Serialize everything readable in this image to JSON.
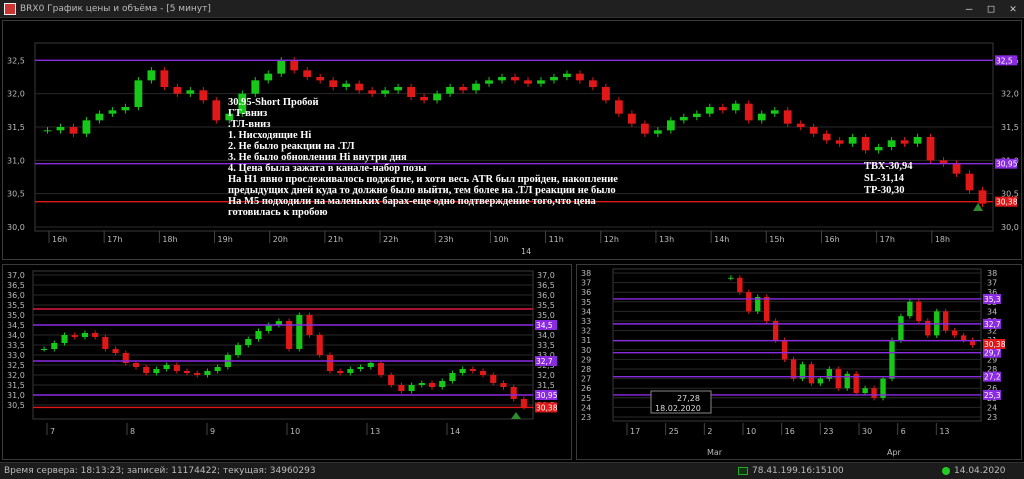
{
  "window": {
    "title": "BRX0 График цены и объёма - [5 минут]",
    "min_glyph": "–",
    "max_glyph": "□",
    "close_glyph": "✕"
  },
  "colors": {
    "bull": "#18c818",
    "bear": "#e01818",
    "level": "#8a2be2",
    "resist": "#e01840",
    "grid": "#2a2a2a",
    "axis": "#bbbbbb"
  },
  "main_chart": {
    "chart_data": {
      "type": "candlestick",
      "ylim": [
        30.0,
        32.7
      ],
      "yticks": [
        "32,5",
        "32,0",
        "31,5",
        "31,0",
        "30,5",
        "30,0"
      ],
      "ytick_values": [
        32.5,
        32.0,
        31.5,
        31.0,
        30.5,
        30.0
      ],
      "xticks": [
        "16h",
        "17h",
        "18h",
        "19h",
        "20h",
        "21h",
        "22h",
        "23h",
        "10h",
        "11h",
        "12h",
        "13h",
        "14h",
        "15h",
        "16h",
        "17h",
        "18h"
      ],
      "date_label": "14",
      "levels": [
        {
          "value": 32.5,
          "label": "32,5",
          "color": "#8a2be2"
        },
        {
          "value": 30.95,
          "label": "30,95",
          "color": "#8a2be2"
        },
        {
          "value": 30.38,
          "label": "30,38",
          "color": "#e01818"
        }
      ],
      "closes": [
        31.45,
        31.5,
        31.4,
        31.6,
        31.7,
        31.75,
        31.8,
        32.2,
        32.35,
        32.1,
        32.0,
        32.05,
        31.9,
        31.6,
        31.7,
        32.0,
        32.2,
        32.3,
        32.5,
        32.35,
        32.25,
        32.2,
        32.1,
        32.15,
        32.05,
        32.0,
        32.05,
        32.1,
        31.95,
        31.9,
        32.0,
        32.1,
        32.05,
        32.15,
        32.2,
        32.25,
        32.2,
        32.15,
        32.2,
        32.25,
        32.3,
        32.2,
        32.1,
        31.9,
        31.7,
        31.55,
        31.4,
        31.45,
        31.6,
        31.65,
        31.7,
        31.8,
        31.75,
        31.85,
        31.6,
        31.7,
        31.75,
        31.55,
        31.5,
        31.4,
        31.3,
        31.25,
        31.35,
        31.15,
        31.2,
        31.3,
        31.25,
        31.35,
        31.0,
        30.95,
        30.8,
        30.55,
        30.35
      ],
      "tick_count": 17
    },
    "annotation_lines": [
      "30.95-Short Пробой",
      "ГТ-вниз",
      ".ТЛ-вниз",
      "1. Нисходящие Hi",
      "2. Не было реакции на .ТЛ",
      "3. Не было обновления Hi внутри дня",
      "4. Цена была зажата в канале-набор позы",
      "На H1 явно прослеживалось поджатие, и хотя весь ATR был пройден, накопление",
      "предыдущих дней куда то должно было выйти, тем более на .ТЛ реакции не было",
      "На М5 подходили на маленьких барах-еще одно подтверждение того,что цена",
      "готовилась к пробою"
    ],
    "trade": {
      "entry": "ТВХ-30,94",
      "stop": "SL-31,14",
      "target": "TP-30,30"
    }
  },
  "lower_left_chart": {
    "chart_data": {
      "type": "candlestick",
      "ylim": [
        30.0,
        37.0
      ],
      "yticks": [
        "37,0",
        "36,5",
        "36,0",
        "35,5",
        "35,0",
        "34,5",
        "34,0",
        "33,5",
        "33,0",
        "32,5",
        "32,0",
        "31,5",
        "31,0",
        "30,5"
      ],
      "xticks": [
        "7",
        "8",
        "9",
        "10",
        "13",
        "14"
      ],
      "levels": [
        {
          "value": 35.3,
          "label": "",
          "color": "#e01840"
        },
        {
          "value": 34.5,
          "label": "34,5",
          "color": "#8a2be2"
        },
        {
          "value": 32.7,
          "label": "32,7",
          "color": "#8a2be2"
        },
        {
          "value": 31.0,
          "label": "30,95",
          "color": "#8a2be2"
        },
        {
          "value": 30.38,
          "label": "30,38",
          "color": "#e01818"
        }
      ],
      "closes": [
        33.3,
        33.6,
        34.0,
        33.9,
        34.1,
        33.9,
        33.3,
        33.1,
        32.6,
        32.4,
        32.1,
        32.3,
        32.5,
        32.2,
        32.1,
        32.0,
        32.2,
        32.4,
        33.0,
        33.5,
        33.8,
        34.2,
        34.5,
        34.7,
        33.3,
        35.0,
        34.0,
        33.0,
        32.2,
        32.1,
        32.3,
        32.4,
        32.6,
        32.0,
        31.5,
        31.2,
        31.5,
        31.6,
        31.4,
        31.7,
        32.1,
        32.3,
        32.2,
        32.0,
        31.6,
        31.4,
        30.8,
        30.4
      ]
    }
  },
  "lower_right_chart": {
    "chart_data": {
      "type": "candlestick",
      "ylim": [
        23,
        38
      ],
      "yticks": [
        "38",
        "37",
        "36",
        "35",
        "34",
        "33",
        "32",
        "31",
        "30",
        "29",
        "28",
        "27",
        "26",
        "25",
        "24",
        "23"
      ],
      "xticks": [
        "17",
        "25",
        "2",
        "10",
        "16",
        "23",
        "30",
        "6",
        "13"
      ],
      "month_labels": [
        "Mar",
        "Apr"
      ],
      "levels": [
        {
          "value": 35.3,
          "label": "35,3",
          "color": "#8a2be2"
        },
        {
          "value": 32.7,
          "label": "32,7",
          "color": "#8a2be2"
        },
        {
          "value": 30.95,
          "label": "",
          "color": "#8a2be2"
        },
        {
          "value": 29.7,
          "label": "29,7",
          "color": "#8a2be2"
        },
        {
          "value": 27.2,
          "label": "27,2",
          "color": "#8a2be2"
        },
        {
          "value": 25.3,
          "label": "25,3",
          "color": "#8a2be2"
        }
      ],
      "cursor_value": "27,28",
      "cursor_date": "18.02.2020",
      "price_label": "30,38",
      "closes": [
        null,
        null,
        null,
        null,
        null,
        null,
        null,
        null,
        null,
        null,
        null,
        null,
        37.5,
        36.0,
        34.0,
        35.5,
        33.0,
        31.0,
        29.0,
        27.0,
        28.5,
        26.5,
        27.0,
        28.0,
        26.0,
        27.5,
        25.5,
        26.0,
        25.0,
        27.0,
        31.0,
        33.5,
        35.0,
        33.0,
        31.5,
        34.0,
        32.0,
        31.5,
        31.0,
        30.5
      ]
    }
  },
  "status": {
    "server_time": "Время сервера: 18:13:23; записей: 11174422; текущая: 34960293",
    "connection": "78.41.199.16:15100",
    "date": "14.04.2020"
  }
}
